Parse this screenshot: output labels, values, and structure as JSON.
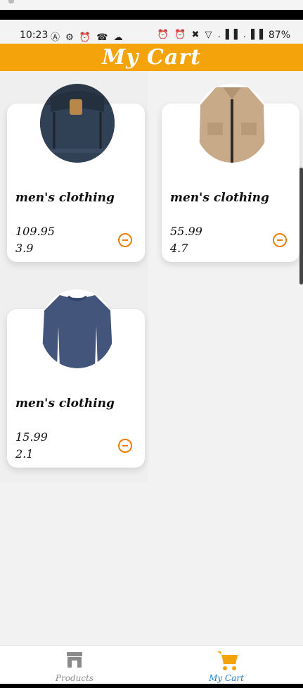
{
  "status_bar": {
    "time": "10:23",
    "left_icons": "Ⓐ ⚙ ⏰ ☎ ☁",
    "right_icons": "⏰ ⏰ ✖ ▽ .▐▐ .▐▐",
    "battery": "87%"
  },
  "app_bar": {
    "title": "My Cart"
  },
  "cart_items": [
    {
      "category": "men's clothing",
      "price": "109.95",
      "rating": "3.9",
      "image": "backpack"
    },
    {
      "category": "men's clothing",
      "price": "55.99",
      "rating": "4.7",
      "image": "jacket"
    },
    {
      "category": "men's clothing",
      "price": "15.99",
      "rating": "2.1",
      "image": "tshirt"
    }
  ],
  "bottom_nav": {
    "items": [
      {
        "label": "Products",
        "icon": "store-icon",
        "active": false
      },
      {
        "label": "My Cart",
        "icon": "cart-icon",
        "active": true
      }
    ]
  },
  "colors": {
    "accent": "#f5a30b",
    "active_tab": "#1a7ac8",
    "remove_icon": "#ef7d00"
  }
}
